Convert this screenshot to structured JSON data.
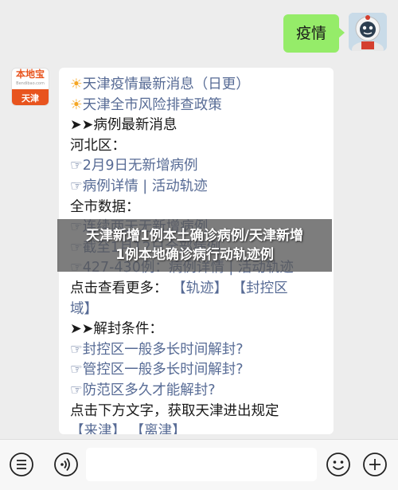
{
  "chat": {
    "outgoing": {
      "text": "疫情"
    },
    "brand": {
      "logo_text": "本地宝",
      "logo_sub": "Bendibao.com",
      "city": "天津"
    },
    "message_lines": [
      {
        "prefix": "☀",
        "text": "天津疫情最新消息（日更）",
        "link": true
      },
      {
        "prefix": "☀",
        "text": "天津全市风险排查政策",
        "link": true
      },
      {
        "prefix": "➤➤",
        "text": "病例最新消息",
        "link": false
      },
      {
        "prefix": "",
        "text": "河北区：",
        "link": false
      },
      {
        "prefix": "☞",
        "text": "2月9日无新增病例",
        "link": true
      },
      {
        "prefix": "☞",
        "text": "病例详情 | 活动轨迹",
        "link": true
      },
      {
        "prefix": "",
        "text": "全市数据：",
        "link": false
      },
      {
        "prefix": "☞",
        "text": "连续两天无新增病例",
        "link": true
      },
      {
        "prefix": "☞",
        "text": "截至1月12日全部病例",
        "link": true
      },
      {
        "prefix": "☞",
        "text": "427-430例：病例详情 | 活动轨迹",
        "link": true
      }
    ],
    "more_prefix": "点击查看更多：",
    "more_link_1": "【轨迹】",
    "more_link_2": "【封控区",
    "more_link_2b": "域】",
    "unseal_title": "➤➤解封条件：",
    "unseal_lines": [
      "☞封控区一般多长时间解封?",
      "☞管控区一般多长时间解封?",
      "☞防范区多久才能解封?"
    ],
    "rules_text": "点击下方文字，获取天津进出规定",
    "rules_link_1": "【来津】",
    "rules_link_2": "【离津】"
  },
  "overlay": {
    "line1": "天津新增1例本土确诊病例/天津新增",
    "line2": "1例本地确诊病行动轨迹例"
  },
  "bottom_bar": {
    "icons": [
      "menu-icon",
      "voice-icon",
      "emoji-icon",
      "plus-icon"
    ]
  }
}
